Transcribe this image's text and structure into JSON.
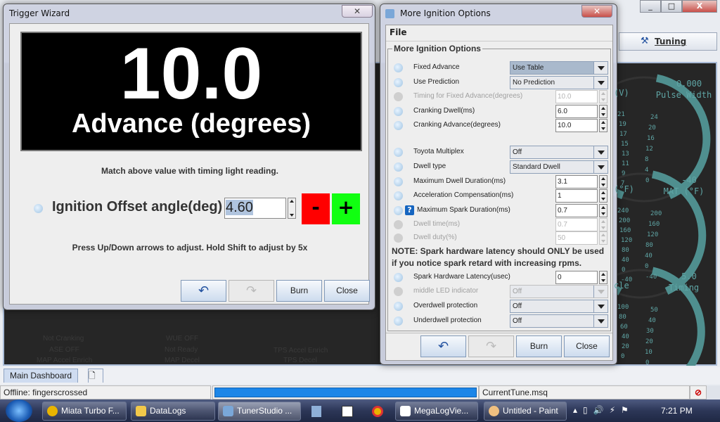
{
  "app": {
    "window_controls": [
      "_",
      "□",
      "X"
    ],
    "tuning_label": "Tuning",
    "dash_labels": [
      "Not Cranking",
      "ASE OFF",
      "MAP Accel Enrich",
      "WUE OFF",
      "Not Ready",
      "MAP Decel",
      "TPS Accel Enrich",
      "TPS Decel"
    ],
    "gauges": [
      {
        "partial_title": "(V)",
        "value": "0.000",
        "title": "Pulse Width",
        "ticks_left": [
          "21",
          "19",
          "17",
          "15",
          "13",
          "11",
          "9",
          "7"
        ],
        "ticks_right": [
          "24",
          "20",
          "16",
          "12",
          "8",
          "4",
          "0"
        ]
      },
      {
        "partial_title": "(°F)",
        "value": "-40",
        "title": "MAT (°F)",
        "ticks_left": [
          "240",
          "200",
          "160",
          "120",
          "80",
          "40",
          "0",
          "-40"
        ],
        "ticks_right": [
          "200",
          "160",
          "120",
          "80",
          "40",
          "0",
          "-40"
        ]
      },
      {
        "partial_title": "cle",
        "value": "5.0",
        "title": "Timing",
        "ticks_left": [
          "100",
          "80",
          "60",
          "40",
          "20",
          "0"
        ],
        "ticks_right": [
          "50",
          "40",
          "30",
          "20",
          "10",
          "0"
        ]
      }
    ],
    "tabs": [
      "Main Dashboard"
    ],
    "status": {
      "connection": "Offline: fingerscrossed",
      "progress": 1.0,
      "tune": "CurrentTune.msq"
    }
  },
  "taskbar": {
    "items": [
      "Miata Turbo F...",
      "DataLogs",
      "TunerStudio ...",
      "MegaLogVie...",
      "Untitled - Paint"
    ],
    "clock": "7:21 PM"
  },
  "trigger": {
    "title": "Trigger Wizard",
    "value": "10.0",
    "value_label": "Advance (degrees)",
    "instruction": "Match above value with timing light reading.",
    "offset_label": "Ignition Offset angle(deg)",
    "offset_value": "4.60",
    "minus": "-",
    "plus": "+",
    "hint": "Press Up/Down arrows to adjust. Hold Shift to adjust by 5x",
    "burn": "Burn",
    "close": "Close"
  },
  "ignition": {
    "title": "More Ignition Options",
    "menu_file": "File",
    "group": "More Ignition Options",
    "rows": [
      {
        "label": "Fixed Advance",
        "type": "select",
        "value": "Use Table",
        "hi": true
      },
      {
        "label": "Use Prediction",
        "type": "select",
        "value": "No Prediction"
      },
      {
        "label": "Timing for Fixed Advance(degrees)",
        "type": "num",
        "value": "10.0",
        "disabled": true
      },
      {
        "label": "Cranking Dwell(ms)",
        "type": "num",
        "value": "6.0"
      },
      {
        "label": "Cranking Advance(degrees)",
        "type": "num",
        "value": "10.0"
      },
      {
        "label": "Toyota Multiplex",
        "type": "select",
        "value": "Off"
      },
      {
        "label": "Dwell type",
        "type": "select",
        "value": "Standard Dwell"
      },
      {
        "label": "Maximum Dwell Duration(ms)",
        "type": "num",
        "value": "3.1"
      },
      {
        "label": "Acceleration Compensation(ms)",
        "type": "num",
        "value": "1"
      },
      {
        "label": "Maximum Spark Duration(ms)",
        "type": "num",
        "value": "0.7",
        "help": true
      },
      {
        "label": "Dwell time(ms)",
        "type": "num",
        "value": "0.7",
        "disabled": true
      },
      {
        "label": "Dwell duty(%)",
        "type": "num",
        "value": "50",
        "disabled": true
      },
      {
        "label": "Spark Hardware Latency(usec)",
        "type": "num",
        "value": "0"
      },
      {
        "label": "middle LED indicator",
        "type": "select",
        "value": "Off",
        "disabled": true
      },
      {
        "label": "Overdwell protection",
        "type": "select",
        "value": "Off"
      },
      {
        "label": "Underdwell protection",
        "type": "select",
        "value": "Off"
      }
    ],
    "note": "NOTE: Spark hardware latency should ONLY be used if you notice spark retard with increasing rpms.",
    "burn": "Burn",
    "close": "Close"
  }
}
